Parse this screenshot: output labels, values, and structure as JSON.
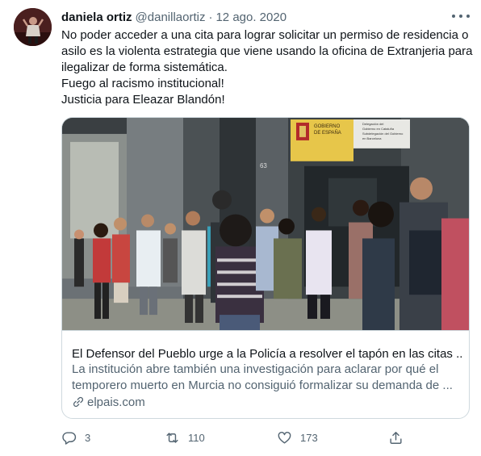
{
  "author": {
    "name": "daniela ortiz",
    "handle": "@danillaortiz",
    "separator": "·",
    "date": "12 ago. 2020"
  },
  "tweet_lines": [
    "No poder acceder a una cita para lograr solicitar un permiso de residencia o",
    "asilo es la violenta estrategia que viene usando la oficina de Extranjeria para",
    "ilegalizar de forma sistemática.",
    "Fuego al racismo institucional!",
    "Justicia para Eleazar Blandón!"
  ],
  "card": {
    "title": "El Defensor del Pueblo urge a la Policía a resolver el tapón en las citas ...",
    "description_lines": [
      "La institución abre también una investigación para aclarar por qué el",
      "temporero muerto en Murcia no consiguió formalizar su demanda de ..."
    ],
    "domain": "elpais.com",
    "image_sign_lines": [
      "GOBIERNO",
      "DE ESPAÑA"
    ],
    "image_sign_lines_right": [
      "Delegación del",
      "Gobierno en Cataluña",
      "Subdelegación del Gobierno",
      "en Barcelona"
    ],
    "image_door_number": "63"
  },
  "actions": {
    "replies": "3",
    "retweets": "110",
    "likes": "173"
  },
  "colors": {
    "text_primary": "#0f1419",
    "text_secondary": "#536471",
    "border": "#cfd9de"
  },
  "icons": {
    "more": "more-horizontal-icon",
    "reply": "reply-icon",
    "retweet": "retweet-icon",
    "like": "heart-icon",
    "share": "share-icon",
    "link": "link-icon"
  }
}
